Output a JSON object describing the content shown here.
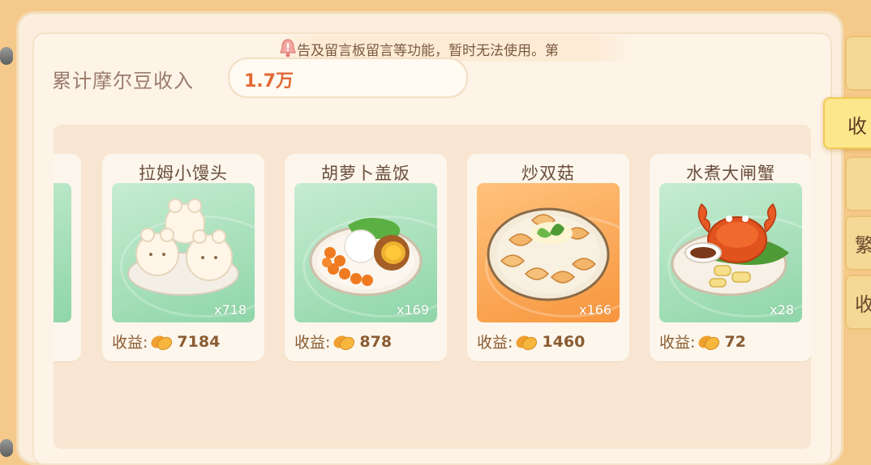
{
  "notice": {
    "text": "告及留言板留言等功能，暂时无法使用。第",
    "icon": "bell-icon"
  },
  "income": {
    "label": "累计摩尔豆收入",
    "value": "1.7万"
  },
  "right_tabs": [
    {
      "label": ""
    },
    {
      "label": "收"
    },
    {
      "label": ""
    },
    {
      "label": "繁"
    },
    {
      "label": "收"
    }
  ],
  "profit_label": "收益:",
  "dishes": [
    {
      "name": "拉姆小馒头",
      "count": "x718",
      "profit": "7184",
      "bg": "green"
    },
    {
      "name": "胡萝卜盖饭",
      "count": "x169",
      "profit": "878",
      "bg": "green"
    },
    {
      "name": "炒双菇",
      "count": "x166",
      "profit": "1460",
      "bg": "orange"
    },
    {
      "name": "水煮大闸蟹",
      "count": "x28",
      "profit": "72",
      "bg": "green"
    }
  ],
  "colors": {
    "accent": "#e06a35",
    "frame": "#f5c98a",
    "panel": "#fdf3e6",
    "tab_active": "#fce78d"
  }
}
